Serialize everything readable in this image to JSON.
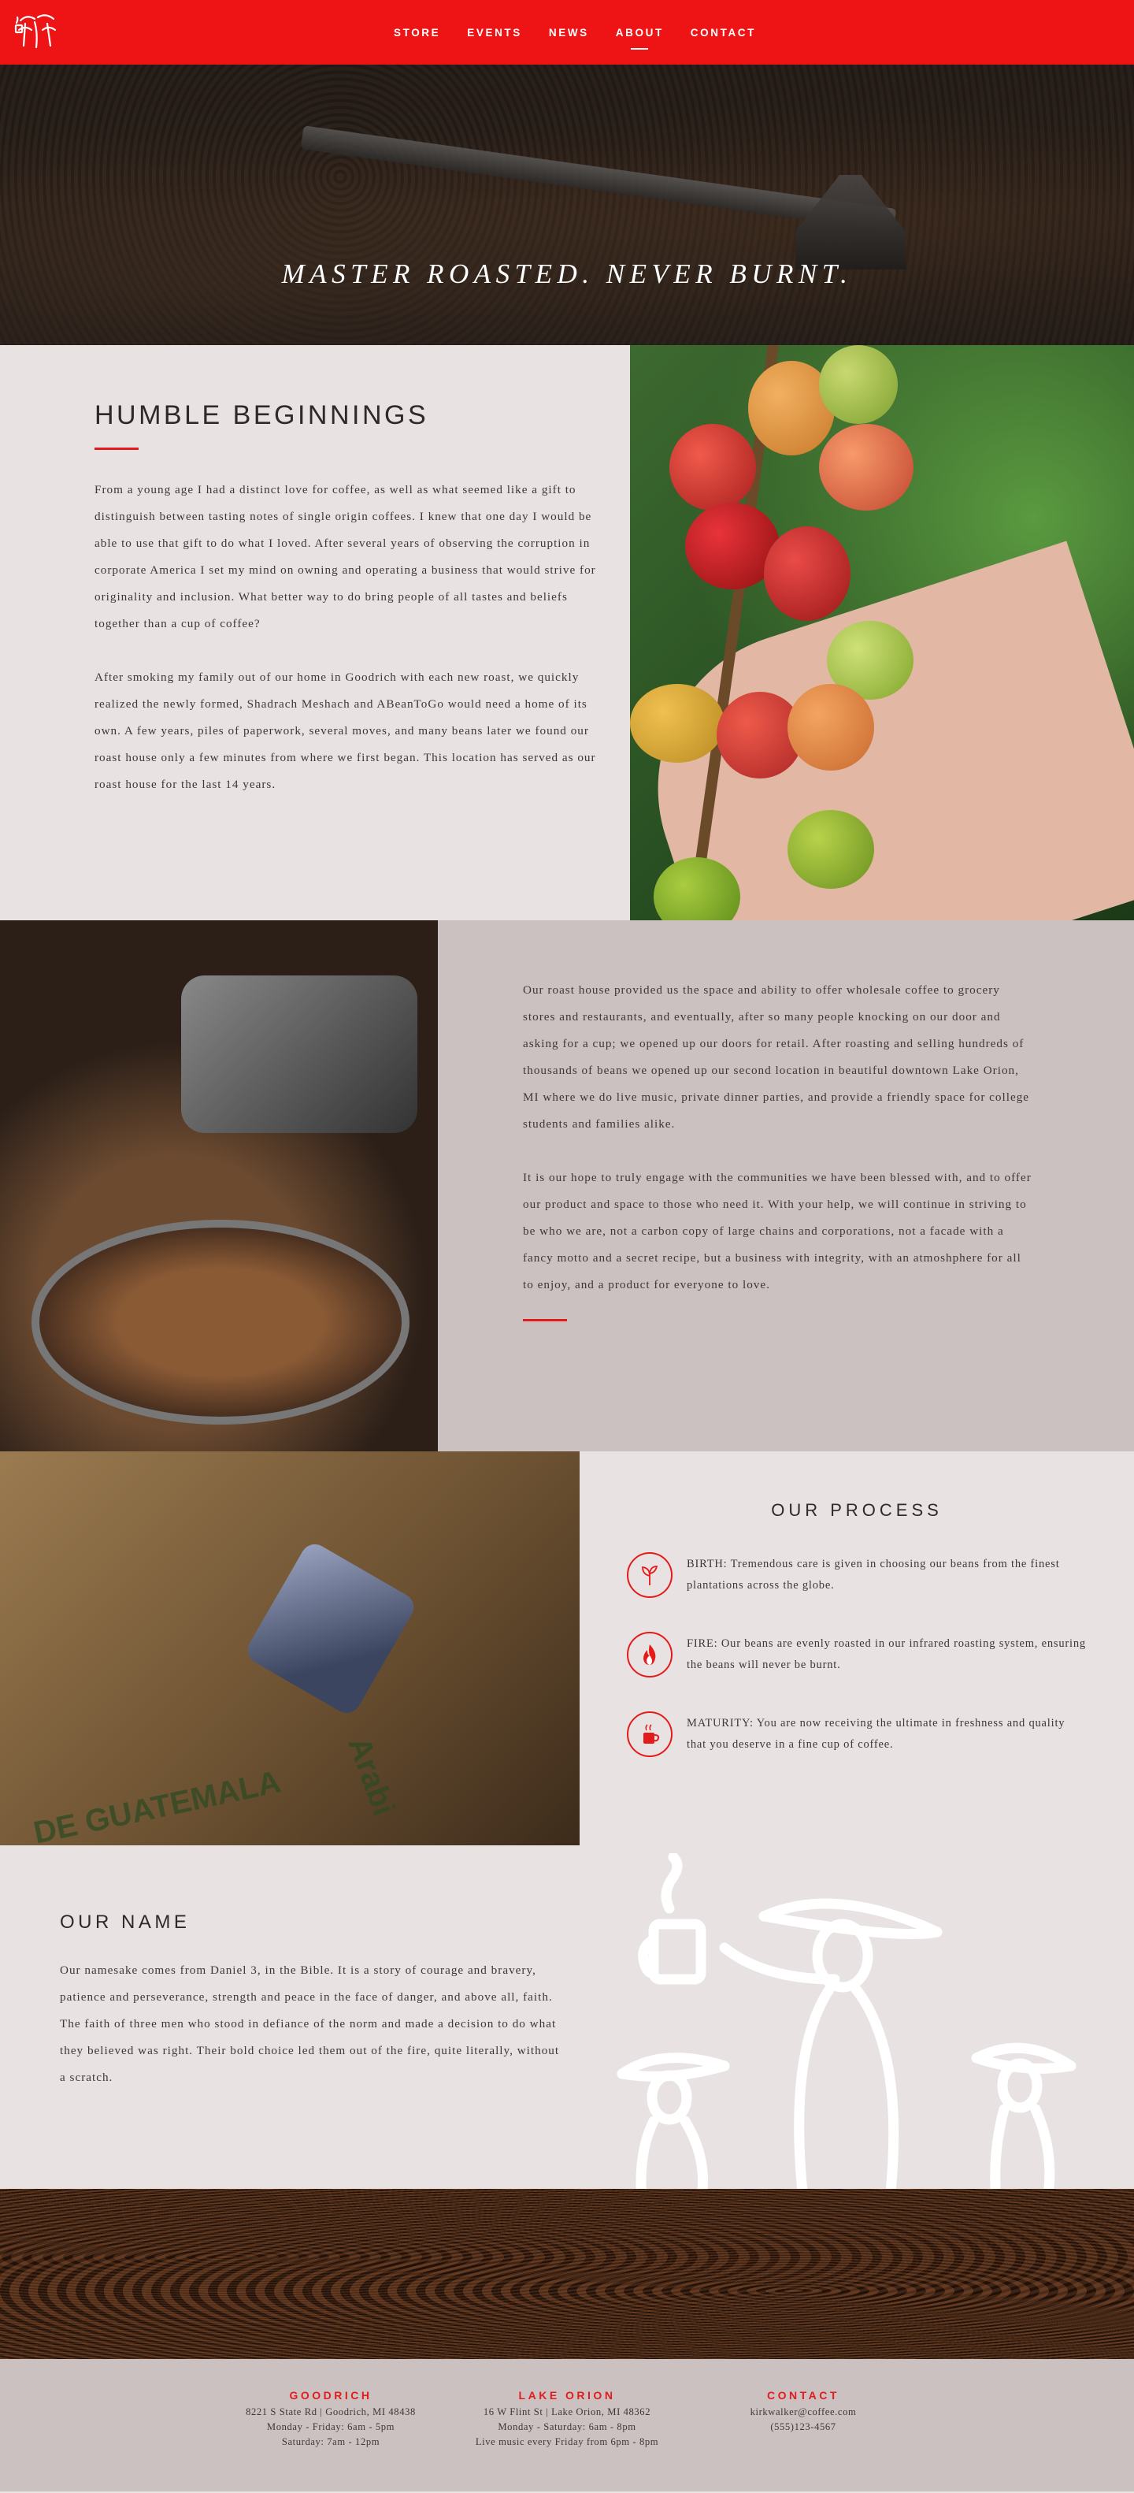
{
  "nav": {
    "items": [
      "STORE",
      "EVENTS",
      "NEWS",
      "ABOUT",
      "CONTACT"
    ],
    "active": "ABOUT"
  },
  "hero": {
    "title": "MASTER ROASTED. NEVER BURNT."
  },
  "humble": {
    "title": "HUMBLE BEGINNINGS",
    "p1": "From a young age I had a distinct love for coffee, as well as what seemed like a gift to distinguish between tasting notes of single origin coffees. I knew that one day I would be able to use that gift to do what I loved. After several years of observing the corruption in corporate America I set my mind on owning and operating a business that would strive for originality and inclusion. What better way to do bring people of all tastes and beliefs together than a cup of coffee?",
    "p2": "After smoking my family out of our home in Goodrich with each new roast, we quickly realized the newly formed, Shadrach Meshach and ABeanToGo would need a home of its own. A few years, piles of paperwork, several moves, and many beans later we found our roast house only a few minutes from where we first began. This location has served as our roast house for the last 14 years."
  },
  "roasthouse": {
    "p1": "Our roast house provided us the space and ability to offer wholesale coffee to grocery stores and restaurants, and eventually, after so many people knocking on our door and asking for a cup; we opened up our doors for retail. After roasting and selling hundreds of thousands of beans we opened up our second location in beautiful downtown Lake Orion, MI where we do live music, private dinner parties, and provide a friendly space for college students and families alike.",
    "p2": "It is our hope to truly engage with the communities we have been blessed with, and to offer our product and space to those who need it. With your help, we will continue in striving to be who we are, not a carbon copy of large chains and corporations, not a facade with a fancy motto and a secret recipe, but a business with integrity, with an atmoshphere for all to enjoy, and a product for everyone to love."
  },
  "process": {
    "title": "OUR PROCESS",
    "steps": [
      {
        "icon": "sprout-icon",
        "text": "BIRTH: Tremendous care is given in choosing our beans from the finest plantations across the globe."
      },
      {
        "icon": "flame-icon",
        "text": "FIRE: Our beans are evenly roasted in our infrared roasting system, ensuring the beans will never be burnt."
      },
      {
        "icon": "coffee-cup-icon",
        "text": "MATURITY: You are now receiving the ultimate in freshness and quality that you deserve in a fine cup of coffee."
      }
    ],
    "sack_text": [
      "DE GUATEMALA",
      "Arabi"
    ]
  },
  "name": {
    "title": "OUR NAME",
    "p": "Our namesake comes from Daniel 3, in the Bible. It is a story of courage and bravery, patience and perseverance, strength and peace in the face of danger, and above all, faith. The faith of three men who stood in defiance of the norm and made a decision to do what they believed was right. Their bold choice led them out of the fire, quite literally, without a scratch."
  },
  "footer": {
    "cols": [
      {
        "title": "GOODRICH",
        "lines": [
          "8221 S State Rd | Goodrich, MI 48438",
          "Monday - Friday: 6am - 5pm",
          "Saturday: 7am - 12pm"
        ]
      },
      {
        "title": "LAKE ORION",
        "lines": [
          "16 W Flint St | Lake Orion, MI 48362",
          "Monday - Saturday: 6am - 8pm",
          "Live music every Friday from 6pm - 8pm"
        ]
      },
      {
        "title": "CONTACT",
        "lines": [
          "kirkwalker@coffee.com",
          "(555)123-4567"
        ]
      }
    ]
  },
  "colors": {
    "accent": "#ee1416",
    "light_bg": "#e8e2e2",
    "mid_bg": "#ccc1c1"
  }
}
